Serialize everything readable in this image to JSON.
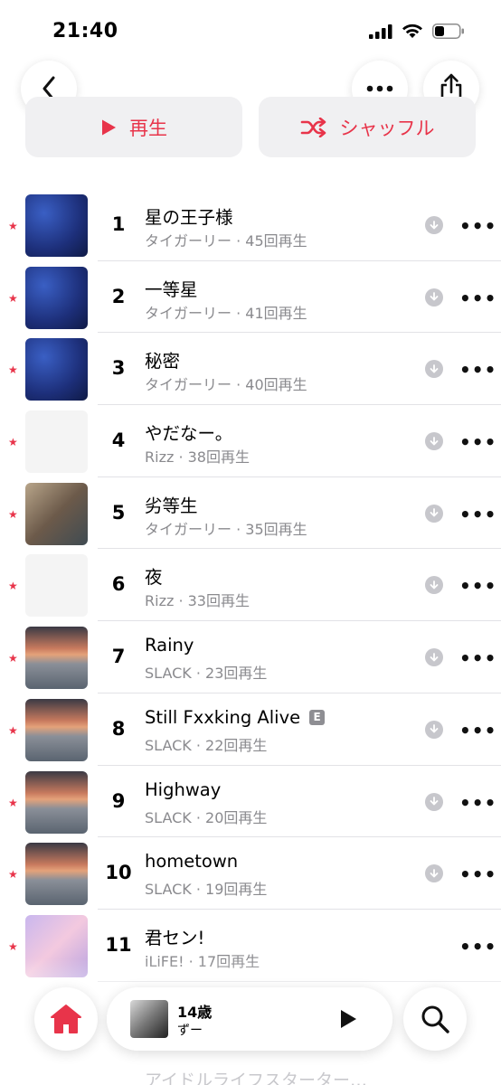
{
  "status": {
    "time": "21:40",
    "icons": [
      "cellular-icon",
      "wifi-icon",
      "battery-icon"
    ]
  },
  "nav": {
    "back_icon": "chevron-left-icon",
    "more_icon": "ellipsis-icon",
    "share_icon": "share-icon"
  },
  "actions": {
    "play_label": "再生",
    "shuffle_label": "シャッフル"
  },
  "colors": {
    "accent": "#e8344a",
    "secondary_text": "#8a8a8e",
    "button_bg": "#f0f0f2"
  },
  "tracks": [
    {
      "num": "1",
      "title": "星の王子様",
      "artist": "タイガーリー",
      "plays": "45回再生",
      "art": "art-star"
    },
    {
      "num": "2",
      "title": "一等星",
      "artist": "タイガーリー",
      "plays": "41回再生",
      "art": "art-star"
    },
    {
      "num": "3",
      "title": "秘密",
      "artist": "タイガーリー",
      "plays": "40回再生",
      "art": "art-star"
    },
    {
      "num": "4",
      "title": "やだなー。",
      "artist": "Rizz",
      "plays": "38回再生",
      "art": "art-manga"
    },
    {
      "num": "5",
      "title": "劣等生",
      "artist": "タイガーリー",
      "plays": "35回再生",
      "art": "art-badge"
    },
    {
      "num": "6",
      "title": "夜",
      "artist": "Rizz",
      "plays": "33回再生",
      "art": "art-manga"
    },
    {
      "num": "7",
      "title": "Rainy",
      "artist": "SLACK",
      "plays": "23回再生",
      "art": "art-sky"
    },
    {
      "num": "8",
      "title": "Still Fxxking Alive",
      "artist": "SLACK",
      "plays": "22回再生",
      "art": "art-sky",
      "explicit": "E"
    },
    {
      "num": "9",
      "title": "Highway",
      "artist": "SLACK",
      "plays": "20回再生",
      "art": "art-sky"
    },
    {
      "num": "10",
      "title": "hometown",
      "artist": "SLACK",
      "plays": "19回再生",
      "art": "art-sky"
    },
    {
      "num": "11",
      "title": "君セン!",
      "artist": "iLiFE!",
      "plays": "17回再生",
      "art": "art-idol"
    }
  ],
  "ghost_row": "アイドルライフスターター…",
  "mini_player": {
    "title": "14歳",
    "artist": "ずー"
  },
  "bottom": {
    "home_icon": "home-icon",
    "search_icon": "search-icon"
  }
}
